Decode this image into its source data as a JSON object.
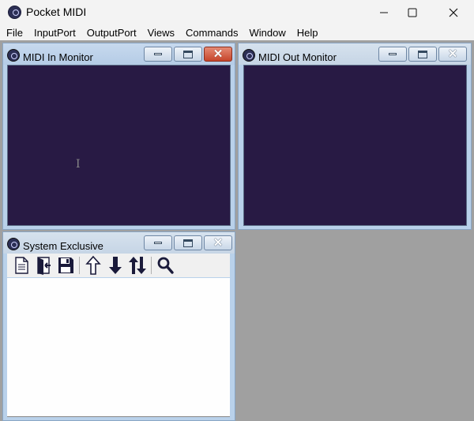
{
  "app": {
    "title": "Pocket MIDI"
  },
  "window_controls": {
    "minimize": "—",
    "maximize": "☐",
    "close": "✕"
  },
  "menu": [
    "File",
    "InputPort",
    "OutputPort",
    "Views",
    "Commands",
    "Window",
    "Help"
  ],
  "midi_in": {
    "title": "MIDI In Monitor"
  },
  "midi_out": {
    "title": "MIDI Out Monitor"
  },
  "sysex": {
    "title": "System Exclusive"
  },
  "colors": {
    "monitor_bg": "#281a44",
    "mdi_bg": "#a0a0a0",
    "titlebar_active": "#b9d1ea"
  },
  "toolbar_icons": [
    "new-document-icon",
    "open-file-icon",
    "save-icon",
    "send-up-icon",
    "receive-down-icon",
    "send-receive-icon",
    "search-icon"
  ]
}
